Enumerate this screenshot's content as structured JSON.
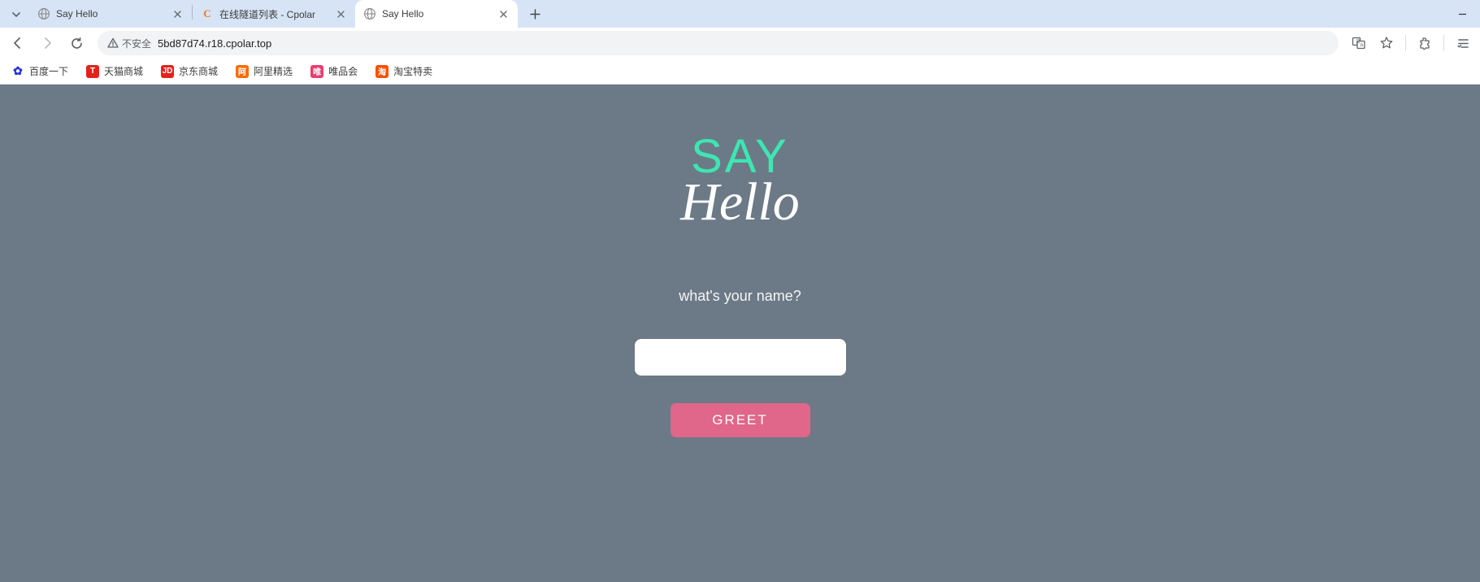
{
  "tabs": [
    {
      "title": "Say Hello"
    },
    {
      "title": "在线隧道列表 - Cpolar"
    },
    {
      "title": "Say Hello"
    }
  ],
  "address": {
    "security_label": "不安全",
    "url": "5bd87d74.r18.cpolar.top"
  },
  "bookmarks": [
    {
      "label": "百度一下"
    },
    {
      "label": "天猫商城"
    },
    {
      "label": "京东商城"
    },
    {
      "label": "阿里精选"
    },
    {
      "label": "唯品会"
    },
    {
      "label": "淘宝特卖"
    }
  ],
  "page": {
    "title_top": "SAY",
    "title_bottom": "Hello",
    "prompt": "what's your name?",
    "input_value": "",
    "button_label": "GREET"
  }
}
